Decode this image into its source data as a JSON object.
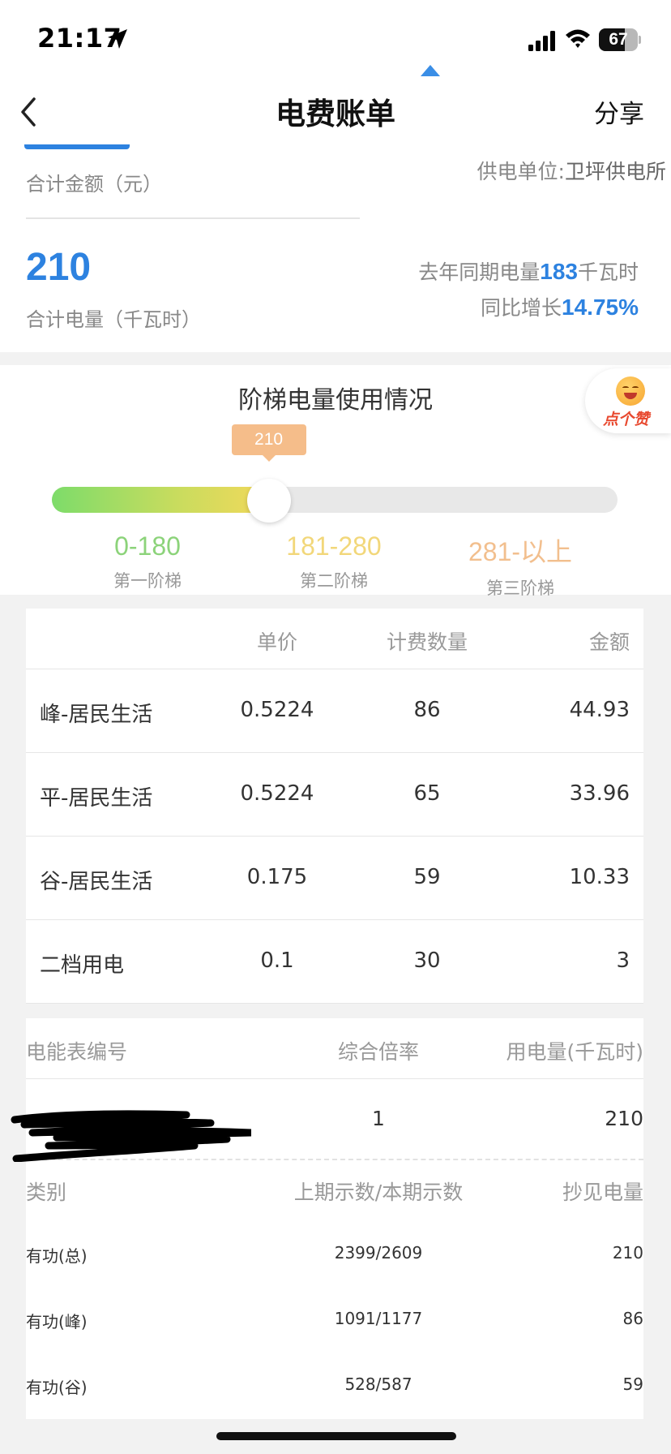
{
  "status_bar": {
    "time": "21:17",
    "battery": "67",
    "battery_level_pct": 67,
    "icons": [
      "location-arrow-icon",
      "cellular-signal-icon",
      "wifi-icon",
      "battery-icon"
    ]
  },
  "nav": {
    "back_icon": "chevron-left-icon",
    "title": "电费账单",
    "share": "分享"
  },
  "summary": {
    "amount_label": "合计金额（元）",
    "supplier_label": "供电单位:",
    "supplier_name": "卫坪供电所",
    "total_kwh": "210",
    "kwh_label": "合计电量（千瓦时）",
    "last_year_prefix": "去年同期电量",
    "last_year_value": "183",
    "last_year_unit": "千瓦时",
    "yoy_prefix": "同比增长",
    "yoy_value": "14.75%"
  },
  "ladder": {
    "title": "阶梯电量使用情况",
    "current": "210",
    "current_value": 210,
    "tiers": [
      {
        "range": "0-180",
        "name": "第一阶梯",
        "color": "#8cd37a"
      },
      {
        "range": "181-280",
        "name": "第二阶梯",
        "color": "#f2d77a"
      },
      {
        "range": "281-以上",
        "name": "第三阶梯",
        "color": "#f2bf8e"
      }
    ],
    "like_badge": "点个赞"
  },
  "price_table": {
    "headers": [
      "",
      "单价",
      "计费数量",
      "金额"
    ],
    "rows": [
      {
        "name": "峰-居民生活",
        "price": "0.5224",
        "qty": "86",
        "amount": "44.93"
      },
      {
        "name": "平-居民生活",
        "price": "0.5224",
        "qty": "65",
        "amount": "33.96"
      },
      {
        "name": "谷-居民生活",
        "price": "0.175",
        "qty": "59",
        "amount": "10.33"
      },
      {
        "name": "二档用电",
        "price": "0.1",
        "qty": "30",
        "amount": "3"
      }
    ]
  },
  "meter": {
    "headers": [
      "电能表编号",
      "综合倍率",
      "用电量(千瓦时)"
    ],
    "row": {
      "id": "",
      "rate": "1",
      "usage": "210"
    },
    "reading_headers": [
      "类别",
      "上期示数/本期示数",
      "抄见电量"
    ],
    "readings": [
      {
        "type": "有功(总)",
        "values": "2399/2609",
        "kwh": "210"
      },
      {
        "type": "有功(峰)",
        "values": "1091/1177",
        "kwh": "86"
      },
      {
        "type": "有功(谷)",
        "values": "528/587",
        "kwh": "59"
      }
    ]
  },
  "colors": {
    "accent_blue": "#2d82e0",
    "tip_orange": "#f5bd8a"
  }
}
